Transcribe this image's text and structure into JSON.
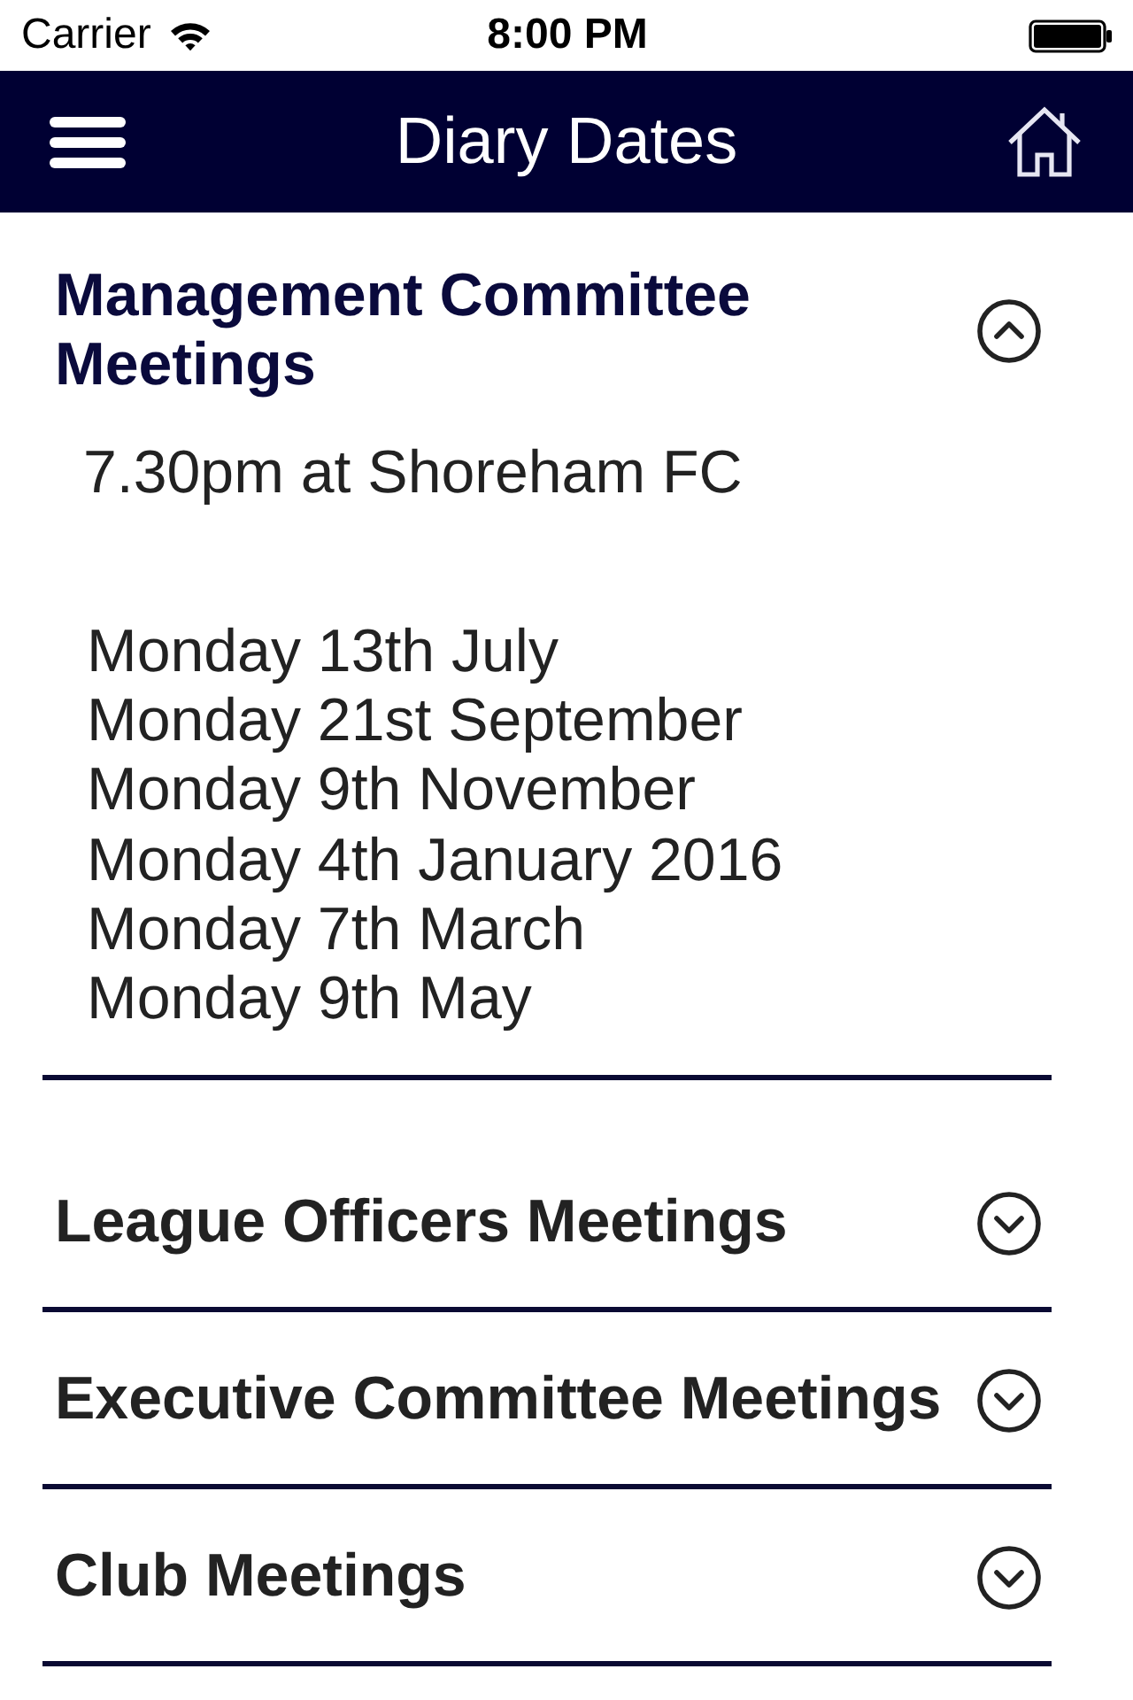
{
  "status_bar": {
    "carrier": "Carrier",
    "time": "8:00 PM"
  },
  "nav_bar": {
    "title": "Diary Dates"
  },
  "sections": [
    {
      "title": "Management Committee Meetings",
      "expanded": true,
      "note": "7.30pm at Shoreham FC",
      "dates": [
        "Monday 13th July",
        "Monday 21st September",
        "Monday 9th November",
        "Monday 4th January 2016",
        "Monday 7th March",
        "Monday 9th May"
      ]
    },
    {
      "title": "League Officers Meetings",
      "expanded": false
    },
    {
      "title": "Executive Committee Meetings",
      "expanded": false
    },
    {
      "title": "Club Meetings",
      "expanded": false
    }
  ]
}
